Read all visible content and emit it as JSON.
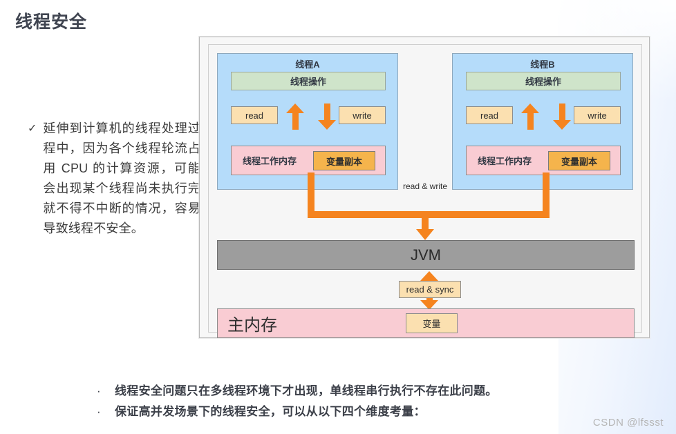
{
  "page": {
    "title": "线程安全",
    "watermark": "CSDN @lfssst"
  },
  "left_note": {
    "marker": "✓",
    "text": "延伸到计算机的线程处理过程中，因为各个线程轮流占用 CPU 的计算资源，可能会出现某个线程尚未执行完就不得不中断的情况，容易导致线程不安全。"
  },
  "diagram": {
    "threads": [
      {
        "title": "线程A",
        "operation": "线程操作",
        "read_label": "read",
        "write_label": "write",
        "working_memory": "线程工作内存",
        "variable_copy": "变量副本"
      },
      {
        "title": "线程B",
        "operation": "线程操作",
        "read_label": "read",
        "write_label": "write",
        "working_memory": "线程工作内存",
        "variable_copy": "变量副本"
      }
    ],
    "bracket_caption": "read & write",
    "jvm_label": "JVM",
    "sync_label": "read & sync",
    "main_memory_label": "主内存",
    "main_memory_variable": "变量",
    "colors": {
      "thread_fill": "#b5dcfa",
      "operation_fill": "#cfe4ca",
      "rw_fill": "#fbe0b0",
      "working_memory_fill": "#f9ccd3",
      "variable_copy_fill": "#f5b44c",
      "arrow": "#f5841f",
      "jvm_fill": "#9d9d9d",
      "main_memory_fill": "#f9ccd3"
    }
  },
  "bullets": [
    {
      "marker": "·",
      "text": "线程安全问题只在多线程环境下才出现，单线程串行执行不存在此问题。"
    },
    {
      "marker": "·",
      "text": "保证高并发场景下的线程安全，可以从以下四个维度考量："
    }
  ]
}
